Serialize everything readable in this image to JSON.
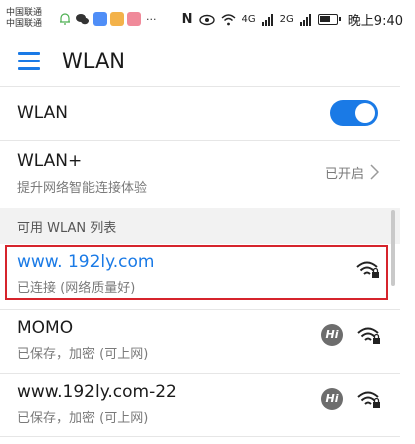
{
  "status_bar": {
    "carrier_1": "中国联通",
    "carrier_2": "中国联通",
    "more": "···",
    "net_4g_1": "4G",
    "net_2g": "2G",
    "time": "晚上9:40"
  },
  "header": {
    "title": "WLAN",
    "accent_color": "#1a7ae6"
  },
  "wlan_toggle": {
    "label": "WLAN",
    "on": true
  },
  "wlan_plus": {
    "label": "WLAN+",
    "description": "提升网络智能连接体验",
    "status": "已开启"
  },
  "section_title": "可用 WLAN 列表",
  "networks": [
    {
      "ssid": "www. 192ly.com",
      "status": "已连接 (网络质量好)",
      "connected": true,
      "hi_badge": false
    },
    {
      "ssid": "MOMO",
      "status": "已保存，加密 (可上网)",
      "connected": false,
      "hi_badge": true,
      "badge_text": "Hi"
    },
    {
      "ssid": "www.192ly.com-22",
      "status": "已保存，加密 (可上网)",
      "connected": false,
      "hi_badge": true,
      "badge_text": "Hi"
    }
  ],
  "highlight_color": "#d6242c"
}
